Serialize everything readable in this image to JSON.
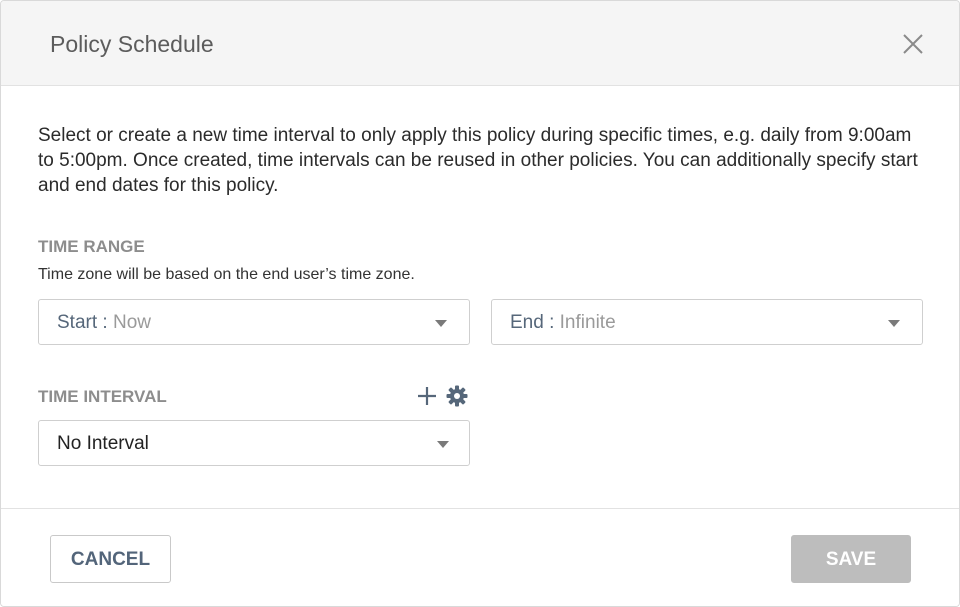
{
  "dialog": {
    "title": "Policy Schedule",
    "close_icon": "close-icon",
    "description": "Select or create a new time interval to only apply this policy during specific times, e.g. daily from 9:00am to 5:00pm. Once created, time intervals can be reused in other policies. You can additionally specify start and end dates for this policy."
  },
  "time_range": {
    "label": "TIME RANGE",
    "note": "Time zone will be based on the end user’s time zone.",
    "start": {
      "key": "Start :",
      "value": "Now"
    },
    "end": {
      "key": "End :",
      "value": "Infinite"
    }
  },
  "time_interval": {
    "label": "TIME INTERVAL",
    "add_icon": "plus-icon",
    "settings_icon": "gear-icon",
    "selected": "No Interval"
  },
  "footer": {
    "cancel_label": "CANCEL",
    "save_label": "SAVE"
  },
  "colors": {
    "header_bg": "#f5f5f5",
    "label_gray": "#8d8d8d",
    "key_blue": "#56677a",
    "save_disabled": "#bdbdbd"
  }
}
